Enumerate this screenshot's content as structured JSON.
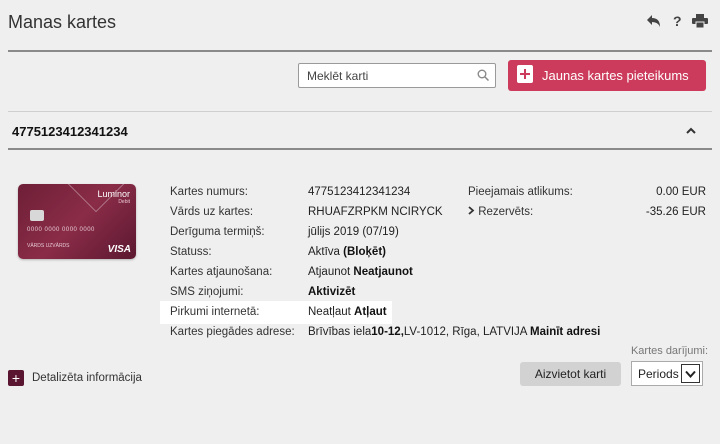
{
  "header": {
    "title": "Manas kartes",
    "icons": [
      "back-icon",
      "help-icon",
      "print-icon"
    ]
  },
  "toolbar": {
    "search_placeholder": "Meklēt karti",
    "new_card_label": "Jaunas kartes pieteikums"
  },
  "accordion": {
    "card_number_title": "4775123412341234"
  },
  "card_image": {
    "brand": "Luminor",
    "type": "Debit",
    "number": "0000 0000 0000 0000",
    "holder": "VĀRDS UZVĀRDS",
    "network": "VISA"
  },
  "details": {
    "card_number_label": "Kartes numurs:",
    "card_number_value": "4775123412341234",
    "name_label": "Vārds uz kartes:",
    "name_value": "RHUAFZRPKM NCIRYCK",
    "expiry_label": "Derīguma termiņš:",
    "expiry_value": "jūlijs 2019 (07/19)",
    "status_label": "Statuss:",
    "status_value": "Aktīva",
    "status_block_link": "(Bloķēt)",
    "renewal_label": "Kartes atjaunošana:",
    "renewal_value": "Atjaunot",
    "renewal_link": "Neatjaunot",
    "sms_label": "SMS ziņojumi:",
    "sms_link": "Aktivizēt",
    "online_label": "Pirkumi internetā:",
    "online_value": "Neatļaut",
    "online_link": "Atļaut",
    "delivery_label": "Kartes piegādes adrese:",
    "delivery_prefix": "Brīvības iela",
    "delivery_bold": "10-12,",
    "delivery_suffix": "LV-1012, Rīga, LATVIJA",
    "delivery_link": "Mainīt adresi"
  },
  "balances": {
    "available_label": "Pieejamais atlikums:",
    "available_value": "0.00 EUR",
    "reserved_label": "Rezervēts:",
    "reserved_value": "-35.26 EUR"
  },
  "footer": {
    "details_label": "Detalizēta informācija",
    "block_button": "Aizvietot karti",
    "transactions_label": "Kartes darījumi:",
    "period_select": "Periods"
  },
  "colors": {
    "accent": "#cc3b5b",
    "card": "#7a2440",
    "dark_plum": "#5a1530"
  }
}
